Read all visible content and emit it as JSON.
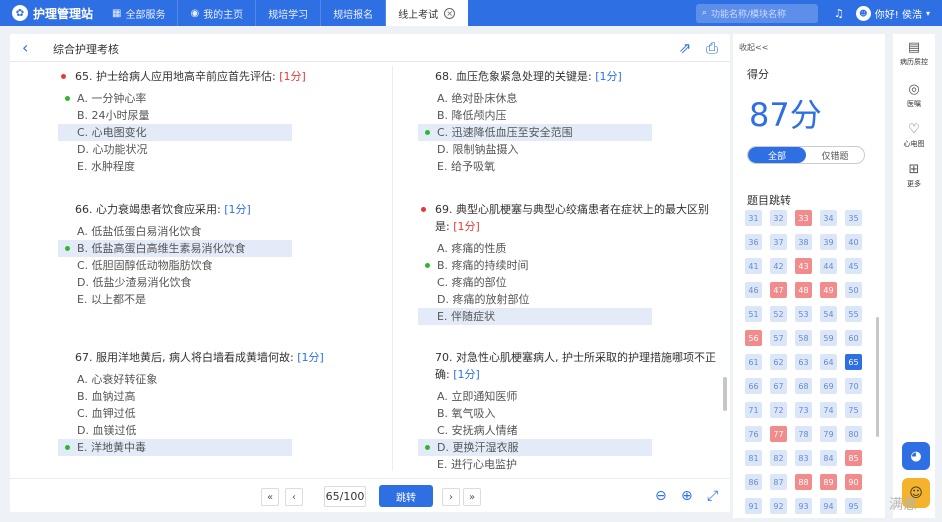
{
  "app": {
    "name": "护理管理站",
    "logo_glyph": "✿"
  },
  "tabs": [
    {
      "icon": "▦",
      "label": "全部服务"
    },
    {
      "icon": "◉",
      "label": "我的主页"
    },
    {
      "icon": "",
      "label": "规培学习"
    },
    {
      "icon": "",
      "label": "规培报名"
    },
    {
      "icon": "",
      "label": "线上考试",
      "active": true
    }
  ],
  "search": {
    "placeholder": "功能名称/模块名称"
  },
  "user": {
    "greeting": "你好! 侯浩"
  },
  "page": {
    "title": "综合护理考核"
  },
  "questions": [
    {
      "num": "65.",
      "text": "护士给病人应用地高辛前应首先评估:",
      "score": "[1分]",
      "flag": true,
      "options": [
        {
          "text": "A. 一分钟心率",
          "correct": false,
          "selected": true
        },
        {
          "text": "B. 24小时尿量",
          "correct": false,
          "selected": false
        },
        {
          "text": "C. 心电图变化",
          "correct": true,
          "selected": false
        },
        {
          "text": "D. 心功能状况",
          "correct": false,
          "selected": false
        },
        {
          "text": "E. 水肿程度",
          "correct": false,
          "selected": false
        }
      ]
    },
    {
      "num": "66.",
      "text": "心力衰竭患者饮食应采用:",
      "score": "[1分]",
      "flag": false,
      "options": [
        {
          "text": "A. 低盐低蛋白易消化饮食",
          "correct": false,
          "selected": false
        },
        {
          "text": "B. 低盐高蛋白高维生素易消化饮食",
          "correct": true,
          "selected": true
        },
        {
          "text": "C. 低胆固醇低动物脂肪饮食",
          "correct": false,
          "selected": false
        },
        {
          "text": "D. 低盐少渣易消化饮食",
          "correct": false,
          "selected": false
        },
        {
          "text": "E. 以上都不是",
          "correct": false,
          "selected": false
        }
      ]
    },
    {
      "num": "67.",
      "text": "服用洋地黄后, 病人将白墙看成黄墙何故:",
      "score": "[1分]",
      "flag": false,
      "options": [
        {
          "text": "A. 心衰好转征象",
          "correct": false,
          "selected": false
        },
        {
          "text": "B. 血钠过高",
          "correct": false,
          "selected": false
        },
        {
          "text": "C. 血钾过低",
          "correct": false,
          "selected": false
        },
        {
          "text": "D. 血镁过低",
          "correct": false,
          "selected": false
        },
        {
          "text": "E. 洋地黄中毒",
          "correct": true,
          "selected": true
        }
      ]
    },
    {
      "num": "68.",
      "text": "血压危象紧急处理的关键是:",
      "score": "[1分]",
      "flag": false,
      "options": [
        {
          "text": "A. 绝对卧床休息",
          "correct": false,
          "selected": false
        },
        {
          "text": "B. 降低颅内压",
          "correct": false,
          "selected": false
        },
        {
          "text": "C. 迅速降低血压至安全范围",
          "correct": true,
          "selected": true
        },
        {
          "text": "D. 限制钠盐摄入",
          "correct": false,
          "selected": false
        },
        {
          "text": "E. 给予吸氧",
          "correct": false,
          "selected": false
        }
      ]
    },
    {
      "num": "69.",
      "text": "典型心肌梗塞与典型心绞痛患者在症状上的最大区别是:",
      "score": "[1分]",
      "flag": true,
      "options": [
        {
          "text": "A. 疼痛的性质",
          "correct": false,
          "selected": false
        },
        {
          "text": "B. 疼痛的持续时间",
          "correct": false,
          "selected": true
        },
        {
          "text": "C. 疼痛的部位",
          "correct": false,
          "selected": false
        },
        {
          "text": "D. 疼痛的放射部位",
          "correct": false,
          "selected": false
        },
        {
          "text": "E. 伴随症状",
          "correct": true,
          "selected": false
        }
      ]
    },
    {
      "num": "70.",
      "text": "对急性心肌梗塞病人, 护士所采取的护理措施哪项不正确:",
      "score": "[1分]",
      "flag": false,
      "options": [
        {
          "text": "A. 立即通知医师",
          "correct": false,
          "selected": false
        },
        {
          "text": "B. 氧气吸入",
          "correct": false,
          "selected": false
        },
        {
          "text": "C. 安抚病人情绪",
          "correct": false,
          "selected": false
        },
        {
          "text": "D. 更换汗湿衣服",
          "correct": true,
          "selected": true
        },
        {
          "text": "E. 进行心电监护",
          "correct": false,
          "selected": false
        }
      ]
    }
  ],
  "pagination": {
    "first": "«",
    "prev": "‹",
    "current": "65/100",
    "jump": "跳转",
    "next": "›",
    "last": "»"
  },
  "panel": {
    "collapse": "收起<<",
    "score_label": "得分",
    "score_value": "87分",
    "filter_all": "全部",
    "filter_wrong": "仅错题",
    "jump_title": "题目跳转",
    "grid": [
      {
        "n": "31",
        "s": "n"
      },
      {
        "n": "32",
        "s": "n"
      },
      {
        "n": "33",
        "s": "w"
      },
      {
        "n": "34",
        "s": "n"
      },
      {
        "n": "35",
        "s": "n"
      },
      {
        "n": "36",
        "s": "n"
      },
      {
        "n": "37",
        "s": "n"
      },
      {
        "n": "38",
        "s": "n"
      },
      {
        "n": "39",
        "s": "n"
      },
      {
        "n": "40",
        "s": "n"
      },
      {
        "n": "41",
        "s": "n"
      },
      {
        "n": "42",
        "s": "n"
      },
      {
        "n": "43",
        "s": "w"
      },
      {
        "n": "44",
        "s": "n"
      },
      {
        "n": "45",
        "s": "n"
      },
      {
        "n": "46",
        "s": "n"
      },
      {
        "n": "47",
        "s": "w"
      },
      {
        "n": "48",
        "s": "w"
      },
      {
        "n": "49",
        "s": "w"
      },
      {
        "n": "50",
        "s": "n"
      },
      {
        "n": "51",
        "s": "n"
      },
      {
        "n": "52",
        "s": "n"
      },
      {
        "n": "53",
        "s": "n"
      },
      {
        "n": "54",
        "s": "n"
      },
      {
        "n": "55",
        "s": "n"
      },
      {
        "n": "56",
        "s": "w"
      },
      {
        "n": "57",
        "s": "n"
      },
      {
        "n": "58",
        "s": "n"
      },
      {
        "n": "59",
        "s": "n"
      },
      {
        "n": "60",
        "s": "n"
      },
      {
        "n": "61",
        "s": "n"
      },
      {
        "n": "62",
        "s": "n"
      },
      {
        "n": "63",
        "s": "n"
      },
      {
        "n": "64",
        "s": "n"
      },
      {
        "n": "65",
        "s": "c"
      },
      {
        "n": "66",
        "s": "n"
      },
      {
        "n": "67",
        "s": "n"
      },
      {
        "n": "68",
        "s": "n"
      },
      {
        "n": "69",
        "s": "n"
      },
      {
        "n": "70",
        "s": "n"
      },
      {
        "n": "71",
        "s": "n"
      },
      {
        "n": "72",
        "s": "n"
      },
      {
        "n": "73",
        "s": "n"
      },
      {
        "n": "74",
        "s": "n"
      },
      {
        "n": "75",
        "s": "n"
      },
      {
        "n": "76",
        "s": "n"
      },
      {
        "n": "77",
        "s": "w"
      },
      {
        "n": "78",
        "s": "n"
      },
      {
        "n": "79",
        "s": "n"
      },
      {
        "n": "80",
        "s": "n"
      },
      {
        "n": "81",
        "s": "n"
      },
      {
        "n": "82",
        "s": "n"
      },
      {
        "n": "83",
        "s": "n"
      },
      {
        "n": "84",
        "s": "n"
      },
      {
        "n": "85",
        "s": "w"
      },
      {
        "n": "86",
        "s": "n"
      },
      {
        "n": "87",
        "s": "n"
      },
      {
        "n": "88",
        "s": "w"
      },
      {
        "n": "89",
        "s": "w"
      },
      {
        "n": "90",
        "s": "w"
      },
      {
        "n": "91",
        "s": "n"
      },
      {
        "n": "92",
        "s": "n"
      },
      {
        "n": "93",
        "s": "n"
      },
      {
        "n": "94",
        "s": "n"
      },
      {
        "n": "95",
        "s": "n"
      }
    ]
  },
  "tools": [
    {
      "icon": "▤",
      "label": "病历质控"
    },
    {
      "icon": "◎",
      "label": "医嘱"
    },
    {
      "icon": "♡",
      "label": "心电图"
    },
    {
      "icon": "⊞",
      "label": "更多"
    }
  ],
  "mascot": {
    "label": "满意"
  },
  "colors": {
    "primary": "#2f6fe4",
    "wrong": "#f28b8b",
    "correct_dot": "#2eb82e",
    "flag": "#e53935"
  }
}
